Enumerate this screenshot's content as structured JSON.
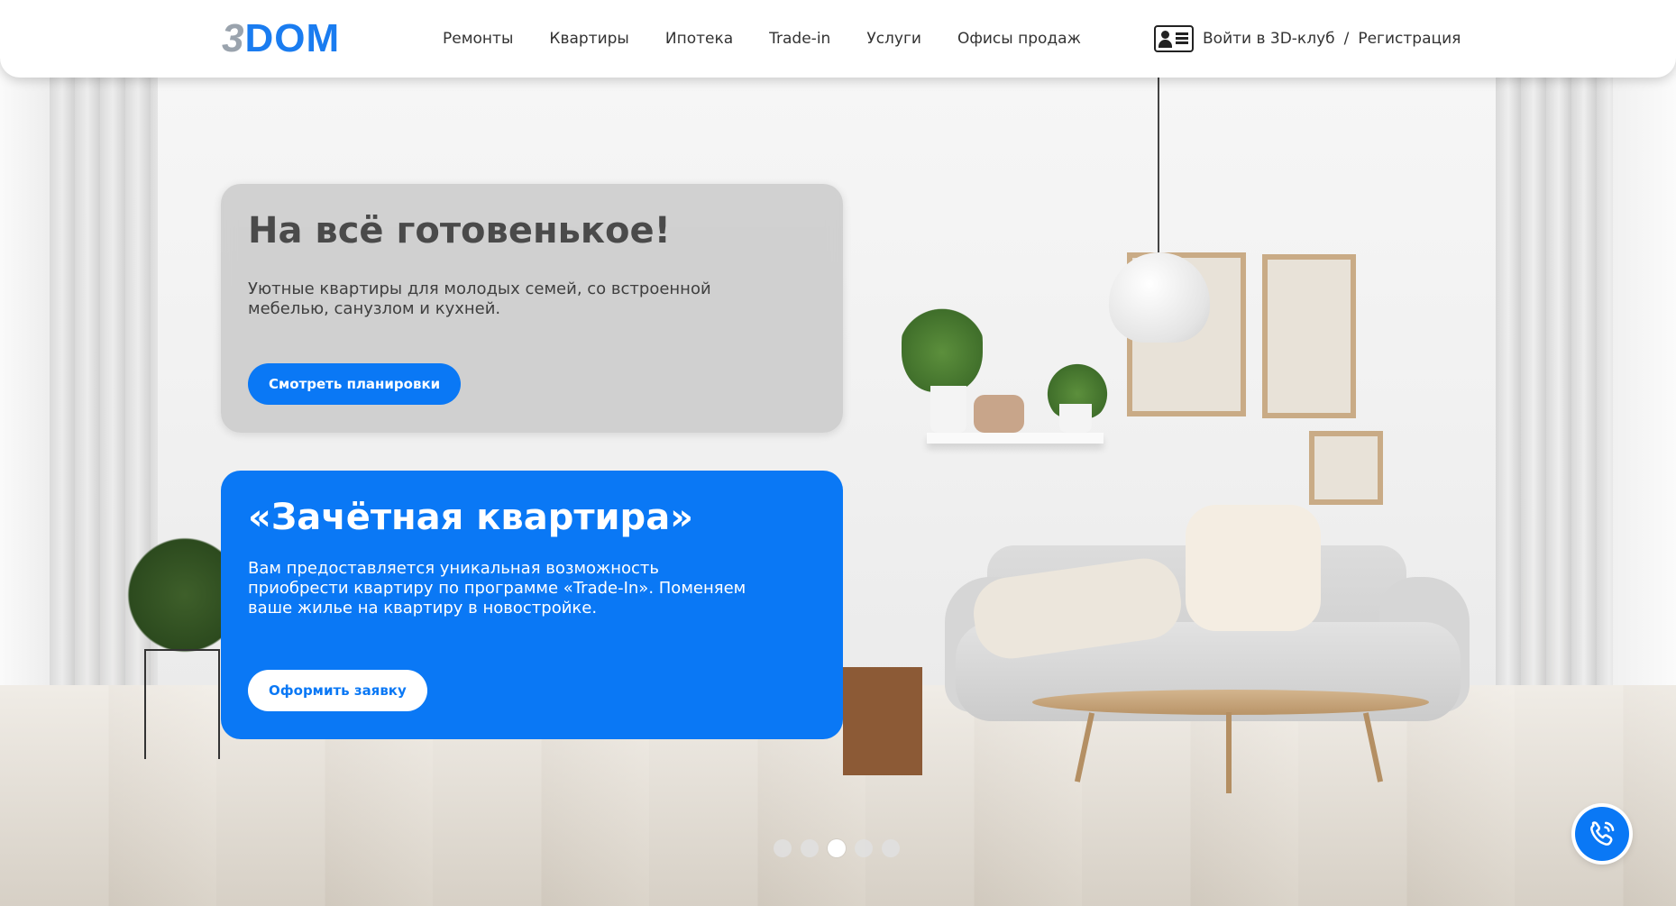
{
  "header": {
    "logo": {
      "part1": "3",
      "part2": "DOM"
    },
    "nav": [
      "Ремонты",
      "Квартиры",
      "Ипотека",
      "Trade-in",
      "Услуги",
      "Офисы продаж"
    ],
    "auth": {
      "login": "Войти в 3D-клуб",
      "separator": "/",
      "register": "Регистрация"
    }
  },
  "hero": {
    "card1": {
      "title": "На всё готовенькое!",
      "text": "Уютные квартиры для молодых семей, со встроенной мебелью, санузлом и кухней.",
      "button": "Смотреть планировки"
    },
    "card2": {
      "title": "«Зачётная квартира»",
      "text": "Вам предоставляется уникальная возможность приобрести квартиру по программе «Trade-In». Поменяем ваше жилье на квартиру в новостройке.",
      "button": "Оформить заявку"
    }
  },
  "slider": {
    "count": 5,
    "active": 3
  },
  "colors": {
    "accent": "#0a78f5",
    "logo_gray": "#9aa3ad",
    "card_gray": "#cdcdcd"
  },
  "icons": {
    "profile": "id-card-icon",
    "call": "phone-icon"
  }
}
